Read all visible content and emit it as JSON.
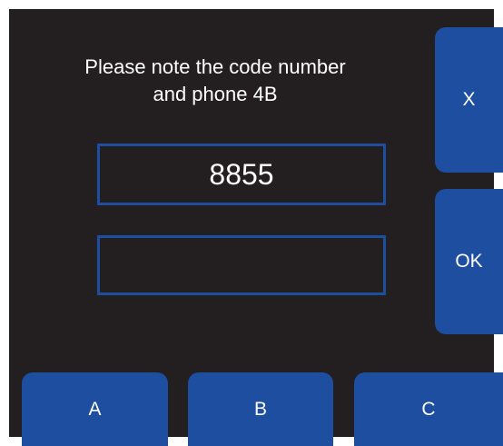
{
  "dialog": {
    "message_line1": "Please note the code number",
    "message_line2": "and phone 4B",
    "code_value": "8855",
    "entry_value": ""
  },
  "buttons": {
    "cancel_label": "X",
    "ok_label": "OK",
    "a_label": "A",
    "b_label": "B",
    "c_label": "C"
  },
  "colors": {
    "background": "#231f20",
    "accent": "#1e4ea0",
    "text": "#ffffff"
  }
}
